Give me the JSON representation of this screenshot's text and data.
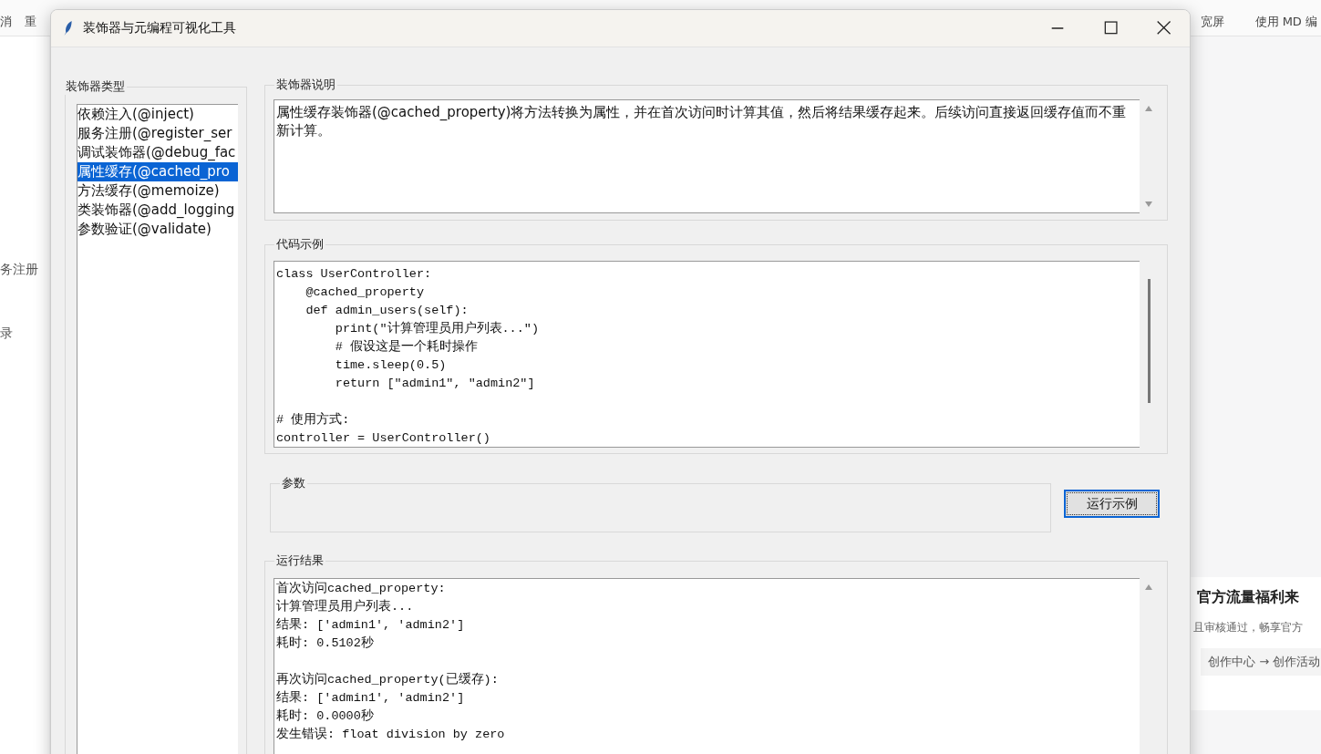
{
  "background": {
    "toolbar_left": [
      "消",
      "重"
    ],
    "toolbar_right": [
      "宽屏",
      "使用 MD 编"
    ],
    "side_items": [
      "务注册",
      "录"
    ],
    "promo": {
      "title": "官方流量福利来",
      "text": "且审核通过，畅享官方",
      "link": "创作中心 → 创作活动"
    }
  },
  "window": {
    "title": "装饰器与元编程可视化工具"
  },
  "decorator_types": {
    "label": "装饰器类型",
    "items": [
      {
        "text": "依赖注入(@inject)",
        "selected": false
      },
      {
        "text": "服务注册(@register_ser",
        "selected": false
      },
      {
        "text": "调试装饰器(@debug_fac",
        "selected": false
      },
      {
        "text": "属性缓存(@cached_pro",
        "selected": true
      },
      {
        "text": "方法缓存(@memoize)",
        "selected": false
      },
      {
        "text": "类装饰器(@add_logging",
        "selected": false
      },
      {
        "text": "参数验证(@validate)",
        "selected": false
      }
    ]
  },
  "description": {
    "label": "装饰器说明",
    "text": "属性缓存装饰器(@cached_property)将方法转换为属性，并在首次访问时计算其值，然后将结果缓存起来。后续访问直接返回缓存值而不重新计算。"
  },
  "code_example": {
    "label": "代码示例",
    "blocks": [
      [
        "class UserController:",
        "    @cached_property",
        "    def admin_users(self):",
        "        print(\"计算管理员用户列表...\")",
        "        # 假设这是一个耗时操作",
        "        time.sleep(0.5)",
        "        return [\"admin1\", \"admin2\"]"
      ],
      [
        "# 使用方式:",
        "controller = UserController()"
      ]
    ]
  },
  "params": {
    "label": "参数"
  },
  "run_button": "运行示例",
  "result": {
    "label": "运行结果",
    "blocks": [
      [
        "首次访问cached_property:",
        "计算管理员用户列表...",
        "结果: ['admin1', 'admin2']",
        "耗时: 0.5102秒"
      ],
      [
        "再次访问cached_property(已缓存):",
        "结果: ['admin1', 'admin2']",
        "耗时: 0.0000秒",
        "发生错误: float division by zero"
      ]
    ]
  }
}
